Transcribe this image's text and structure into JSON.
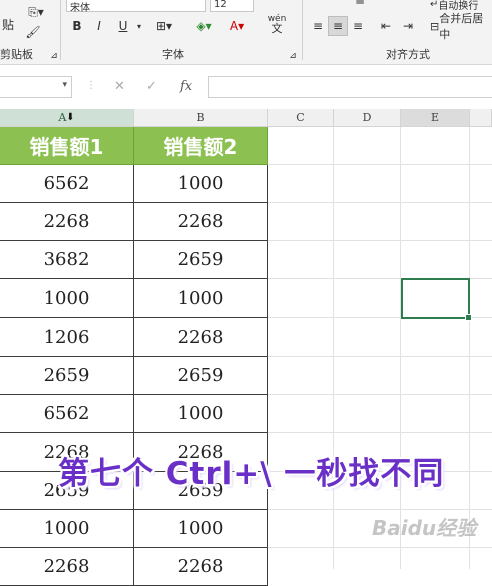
{
  "ribbon": {
    "clipboard_label": "剪贴板",
    "paste_partial": "贴",
    "font_name": "宋体",
    "font_size": "12",
    "bold": "B",
    "italic": "I",
    "underline": "U",
    "font_color_glyph": "A",
    "pinyin_glyph": "文",
    "pinyin_top": "wén",
    "font_group_label": "字体",
    "align_group_label": "对齐方式",
    "merge_label": "合并后居中",
    "wrap_label": "自动换行"
  },
  "formula_bar": {
    "fx": "fx",
    "cancel": "✕",
    "confirm": "✓",
    "value": ""
  },
  "columns": [
    "A",
    "B",
    "C",
    "D",
    "E"
  ],
  "table": {
    "headers": [
      "销售额1",
      "销售额2"
    ],
    "rows": [
      [
        "6562",
        "1000"
      ],
      [
        "2268",
        "2268"
      ],
      [
        "3682",
        "2659"
      ],
      [
        "1000",
        "1000"
      ],
      [
        "1206",
        "2268"
      ],
      [
        "2659",
        "2659"
      ],
      [
        "6562",
        "1000"
      ],
      [
        "2268",
        "2268"
      ],
      [
        "2659",
        "2659"
      ],
      [
        "1000",
        "1000"
      ],
      [
        "2268",
        "2268"
      ]
    ]
  },
  "caption": "第七个 Ctrl+\\ 一秒找不同",
  "watermark": "Baidu经验",
  "colors": {
    "header_green": "#8cc152",
    "caption_purple": "#6a2fc7",
    "selection_green": "#2e7d4f"
  }
}
